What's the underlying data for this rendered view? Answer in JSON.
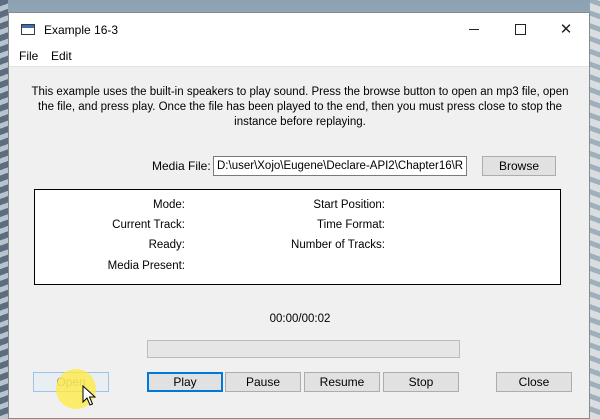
{
  "window": {
    "title": "Example 16-3"
  },
  "menu": {
    "file": "File",
    "edit": "Edit"
  },
  "description": "This example uses the built-in speakers to play sound. Press the browse button to open an mp3 file, open the file, and press play. Once the file has been played to the end, then you must press close to stop the instance before replaying.",
  "media": {
    "label": "Media File:",
    "path": "D:\\user\\Xojo\\Eugene\\Declare-API2\\Chapter16\\R",
    "browse_label": "Browse"
  },
  "info": {
    "mode_label": "Mode:",
    "current_track_label": "Current Track:",
    "ready_label": "Ready:",
    "media_present_label": "Media Present:",
    "start_position_label": "Start Position:",
    "time_format_label": "Time Format:",
    "number_of_tracks_label": "Number of Tracks:"
  },
  "playback": {
    "time": "00:00/00:02",
    "progress": 0
  },
  "buttons": {
    "open": "Open",
    "play": "Play",
    "pause": "Pause",
    "resume": "Resume",
    "stop": "Stop",
    "close": "Close"
  },
  "icons": {
    "app": "window-app-icon",
    "minimize": "minimize-icon",
    "maximize": "maximize-icon",
    "close": "close-icon",
    "cursor": "mouse-pointer-icon"
  }
}
